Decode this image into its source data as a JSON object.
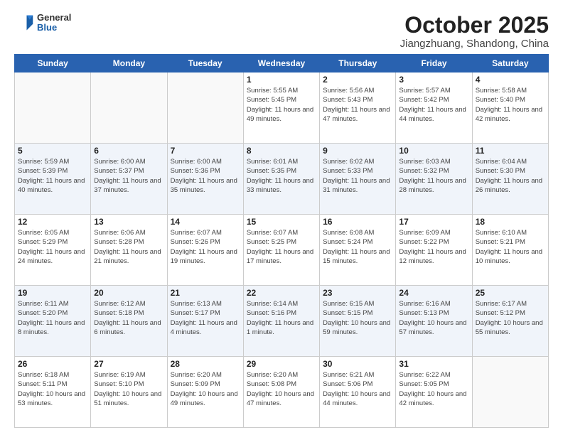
{
  "logo": {
    "general": "General",
    "blue": "Blue"
  },
  "title": "October 2025",
  "location": "Jiangzhuang, Shandong, China",
  "days_header": [
    "Sunday",
    "Monday",
    "Tuesday",
    "Wednesday",
    "Thursday",
    "Friday",
    "Saturday"
  ],
  "weeks": [
    [
      {
        "day": "",
        "info": ""
      },
      {
        "day": "",
        "info": ""
      },
      {
        "day": "",
        "info": ""
      },
      {
        "day": "1",
        "info": "Sunrise: 5:55 AM\nSunset: 5:45 PM\nDaylight: 11 hours\nand 49 minutes."
      },
      {
        "day": "2",
        "info": "Sunrise: 5:56 AM\nSunset: 5:43 PM\nDaylight: 11 hours\nand 47 minutes."
      },
      {
        "day": "3",
        "info": "Sunrise: 5:57 AM\nSunset: 5:42 PM\nDaylight: 11 hours\nand 44 minutes."
      },
      {
        "day": "4",
        "info": "Sunrise: 5:58 AM\nSunset: 5:40 PM\nDaylight: 11 hours\nand 42 minutes."
      }
    ],
    [
      {
        "day": "5",
        "info": "Sunrise: 5:59 AM\nSunset: 5:39 PM\nDaylight: 11 hours\nand 40 minutes."
      },
      {
        "day": "6",
        "info": "Sunrise: 6:00 AM\nSunset: 5:37 PM\nDaylight: 11 hours\nand 37 minutes."
      },
      {
        "day": "7",
        "info": "Sunrise: 6:00 AM\nSunset: 5:36 PM\nDaylight: 11 hours\nand 35 minutes."
      },
      {
        "day": "8",
        "info": "Sunrise: 6:01 AM\nSunset: 5:35 PM\nDaylight: 11 hours\nand 33 minutes."
      },
      {
        "day": "9",
        "info": "Sunrise: 6:02 AM\nSunset: 5:33 PM\nDaylight: 11 hours\nand 31 minutes."
      },
      {
        "day": "10",
        "info": "Sunrise: 6:03 AM\nSunset: 5:32 PM\nDaylight: 11 hours\nand 28 minutes."
      },
      {
        "day": "11",
        "info": "Sunrise: 6:04 AM\nSunset: 5:30 PM\nDaylight: 11 hours\nand 26 minutes."
      }
    ],
    [
      {
        "day": "12",
        "info": "Sunrise: 6:05 AM\nSunset: 5:29 PM\nDaylight: 11 hours\nand 24 minutes."
      },
      {
        "day": "13",
        "info": "Sunrise: 6:06 AM\nSunset: 5:28 PM\nDaylight: 11 hours\nand 21 minutes."
      },
      {
        "day": "14",
        "info": "Sunrise: 6:07 AM\nSunset: 5:26 PM\nDaylight: 11 hours\nand 19 minutes."
      },
      {
        "day": "15",
        "info": "Sunrise: 6:07 AM\nSunset: 5:25 PM\nDaylight: 11 hours\nand 17 minutes."
      },
      {
        "day": "16",
        "info": "Sunrise: 6:08 AM\nSunset: 5:24 PM\nDaylight: 11 hours\nand 15 minutes."
      },
      {
        "day": "17",
        "info": "Sunrise: 6:09 AM\nSunset: 5:22 PM\nDaylight: 11 hours\nand 12 minutes."
      },
      {
        "day": "18",
        "info": "Sunrise: 6:10 AM\nSunset: 5:21 PM\nDaylight: 11 hours\nand 10 minutes."
      }
    ],
    [
      {
        "day": "19",
        "info": "Sunrise: 6:11 AM\nSunset: 5:20 PM\nDaylight: 11 hours\nand 8 minutes."
      },
      {
        "day": "20",
        "info": "Sunrise: 6:12 AM\nSunset: 5:18 PM\nDaylight: 11 hours\nand 6 minutes."
      },
      {
        "day": "21",
        "info": "Sunrise: 6:13 AM\nSunset: 5:17 PM\nDaylight: 11 hours\nand 4 minutes."
      },
      {
        "day": "22",
        "info": "Sunrise: 6:14 AM\nSunset: 5:16 PM\nDaylight: 11 hours\nand 1 minute."
      },
      {
        "day": "23",
        "info": "Sunrise: 6:15 AM\nSunset: 5:15 PM\nDaylight: 10 hours\nand 59 minutes."
      },
      {
        "day": "24",
        "info": "Sunrise: 6:16 AM\nSunset: 5:13 PM\nDaylight: 10 hours\nand 57 minutes."
      },
      {
        "day": "25",
        "info": "Sunrise: 6:17 AM\nSunset: 5:12 PM\nDaylight: 10 hours\nand 55 minutes."
      }
    ],
    [
      {
        "day": "26",
        "info": "Sunrise: 6:18 AM\nSunset: 5:11 PM\nDaylight: 10 hours\nand 53 minutes."
      },
      {
        "day": "27",
        "info": "Sunrise: 6:19 AM\nSunset: 5:10 PM\nDaylight: 10 hours\nand 51 minutes."
      },
      {
        "day": "28",
        "info": "Sunrise: 6:20 AM\nSunset: 5:09 PM\nDaylight: 10 hours\nand 49 minutes."
      },
      {
        "day": "29",
        "info": "Sunrise: 6:20 AM\nSunset: 5:08 PM\nDaylight: 10 hours\nand 47 minutes."
      },
      {
        "day": "30",
        "info": "Sunrise: 6:21 AM\nSunset: 5:06 PM\nDaylight: 10 hours\nand 44 minutes."
      },
      {
        "day": "31",
        "info": "Sunrise: 6:22 AM\nSunset: 5:05 PM\nDaylight: 10 hours\nand 42 minutes."
      },
      {
        "day": "",
        "info": ""
      }
    ]
  ]
}
